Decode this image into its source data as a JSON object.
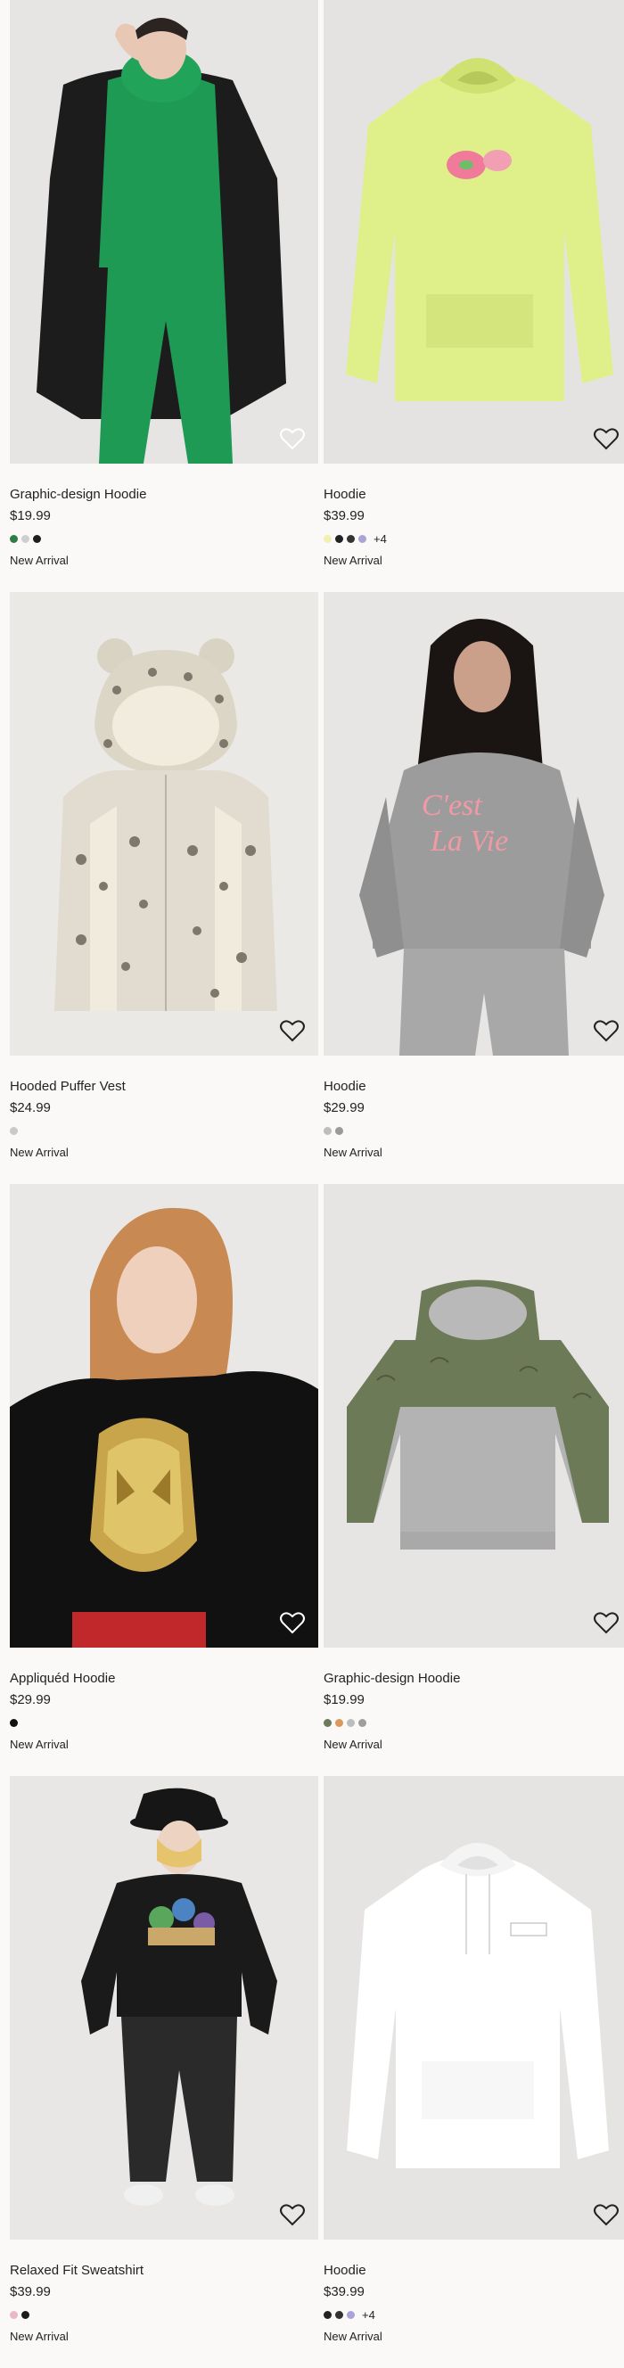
{
  "products": [
    {
      "name": "Graphic-design Hoodie",
      "price": "$19.99",
      "swatches": [
        "#2e7d45",
        "#cfcfcf",
        "#1e1e1e"
      ],
      "more": "",
      "badge": "New Arrival",
      "image": "woman-green-sweatsuit-black-coat"
    },
    {
      "name": "Hoodie",
      "price": "$39.99",
      "swatches": [
        "#f0f0b0",
        "#222222",
        "#333333",
        "#a9a3d6"
      ],
      "more": "+4",
      "badge": "New Arrival",
      "image": "lime-hoodie-patrick-print"
    },
    {
      "name": "Hooded Puffer Vest",
      "price": "$24.99",
      "swatches": [
        "#c9c9c9"
      ],
      "more": "",
      "badge": "New Arrival",
      "image": "leopard-puffer-vest"
    },
    {
      "name": "Hoodie",
      "price": "$29.99",
      "swatches": [
        "#bdbdbd",
        "#9a9a9a"
      ],
      "more": "",
      "badge": "New Arrival",
      "image": "woman-grey-hoodie"
    },
    {
      "name": "Appliquéd Hoodie",
      "price": "$29.99",
      "swatches": [
        "#111111"
      ],
      "more": "",
      "badge": "New Arrival",
      "image": "child-black-spiderman-hoodie"
    },
    {
      "name": "Graphic-design Hoodie",
      "price": "$19.99",
      "swatches": [
        "#6b7a5a",
        "#d99a5e",
        "#bdbdbd",
        "#9e9e9e"
      ],
      "more": "",
      "badge": "New Arrival",
      "image": "green-grey-dino-hoodie"
    },
    {
      "name": "Relaxed Fit Sweatshirt",
      "price": "$39.99",
      "swatches": [
        "#e9b8c4",
        "#1b1b1b"
      ],
      "more": "",
      "badge": "New Arrival",
      "image": "man-black-toystory-sweatshirt"
    },
    {
      "name": "Hoodie",
      "price": "$39.99",
      "swatches": [
        "#222222",
        "#333333",
        "#a9a3d6"
      ],
      "more": "+4",
      "badge": "New Arrival",
      "image": "white-hoodie"
    }
  ]
}
